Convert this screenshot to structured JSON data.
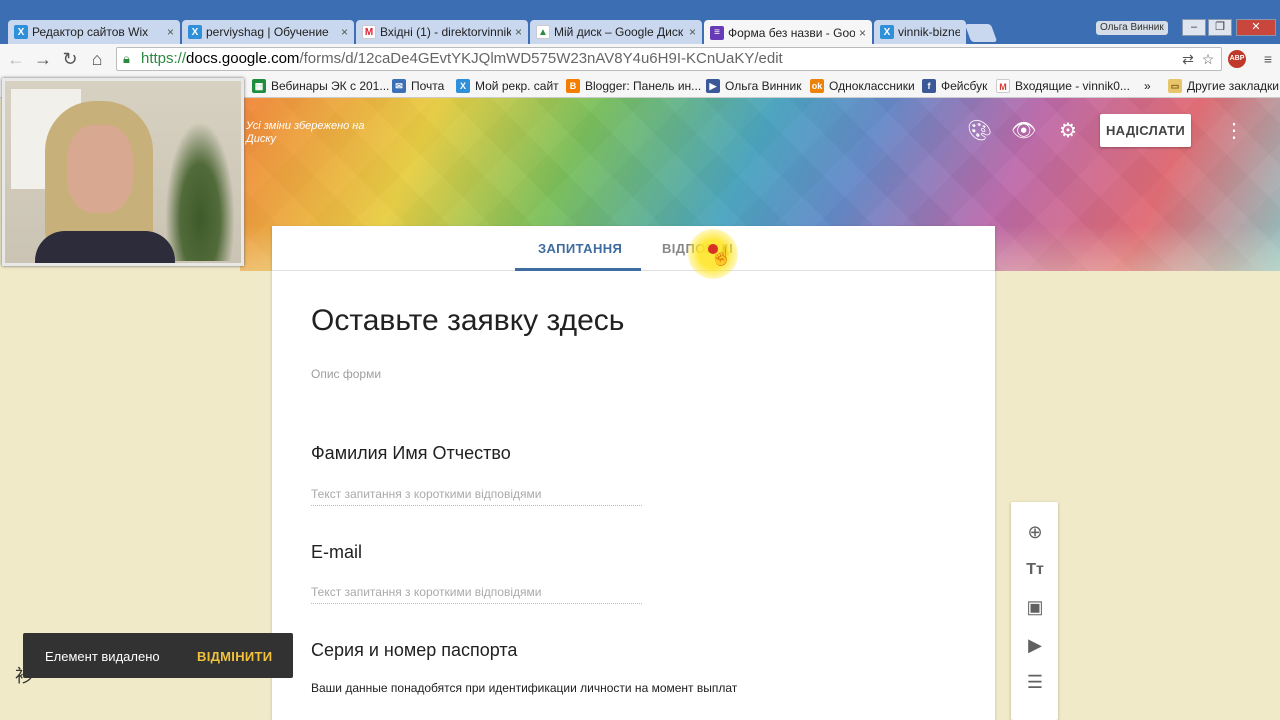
{
  "browser": {
    "tabs": [
      {
        "title": "Редактор сайтов Wix",
        "favicon": "wix-icon",
        "active": false
      },
      {
        "title": "perviyshag | Обучение",
        "favicon": "wix-icon",
        "active": false
      },
      {
        "title": "Вхідні (1) - direktorvinnik",
        "favicon": "gmail-icon",
        "active": false
      },
      {
        "title": "Мій диск – Google Диск",
        "favicon": "google-drive-icon",
        "active": false
      },
      {
        "title": "Форма без назви - Goo",
        "favicon": "google-forms-icon",
        "active": true
      },
      {
        "title": "vinnik-bizness",
        "favicon": "wix-icon",
        "active": false
      }
    ],
    "window_user": "Ольга Винник",
    "url": {
      "scheme": "https://",
      "host": "docs.google.com",
      "path": "/forms/d/12caDe4GEvtYKJQlmWD575W23nAV8Y4u6H9I-KCnUaKY/edit"
    },
    "bookmarks": [
      {
        "label": "Вебинары ЭК с 201...",
        "icon": "sheets-icon",
        "color": "#1e8e3e"
      },
      {
        "label": "Почта",
        "icon": "mail-icon",
        "color": "#3b6fb6"
      },
      {
        "label": "Мой рекр. сайт",
        "icon": "wix-icon",
        "color": "#2f8fd8"
      },
      {
        "label": "Blogger: Панель ин...",
        "icon": "blogger-icon",
        "color": "#f57d00"
      },
      {
        "label": "Ольга Винник",
        "icon": "video-icon",
        "color": "#3b5998"
      },
      {
        "label": "Одноклассники",
        "icon": "odnoklassniki-icon",
        "color": "#ee8208"
      },
      {
        "label": "Фейсбук",
        "icon": "facebook-icon",
        "color": "#3b5998"
      },
      {
        "label": "Входящие - vinnik0...",
        "icon": "gmail-icon",
        "color": "#d23f31"
      }
    ],
    "bookmarks_overflow": "»",
    "other_bookmarks": "Другие закладки"
  },
  "header": {
    "save_status": "Усі зміни збережено на Диску",
    "send_label": "НАДІСЛАТИ",
    "icons": [
      "palette-icon",
      "preview-eye-icon",
      "settings-gear-icon",
      "more-vert-icon"
    ]
  },
  "form_tabs": {
    "questions": "ЗАПИТАННЯ",
    "responses": "ВІДПОВІДІ"
  },
  "form": {
    "title": "Оставьте заявку здесь",
    "description_placeholder": "Опис форми",
    "questions": [
      {
        "title": "Фамилия Имя Отчество",
        "placeholder": "Текст запитання з короткими відповідями"
      },
      {
        "title": "E-mail",
        "placeholder": "Текст запитання з короткими відповідями"
      },
      {
        "title": "Серия и номер паспорта",
        "description": "Ваши данные понадобятся при идентификации личности на момент выплат"
      }
    ]
  },
  "side_toolbar": [
    "add-question-icon",
    "add-title-icon",
    "add-image-icon",
    "add-video-icon",
    "add-section-icon"
  ],
  "snackbar": {
    "message": "Елемент видалено",
    "action": "ВІДМІНИТИ"
  },
  "colors": {
    "accent": "#3f6ca0",
    "page_bg": "#f1eac8",
    "snackbar_bg": "#323232",
    "snackbar_action": "#f0c23c"
  }
}
